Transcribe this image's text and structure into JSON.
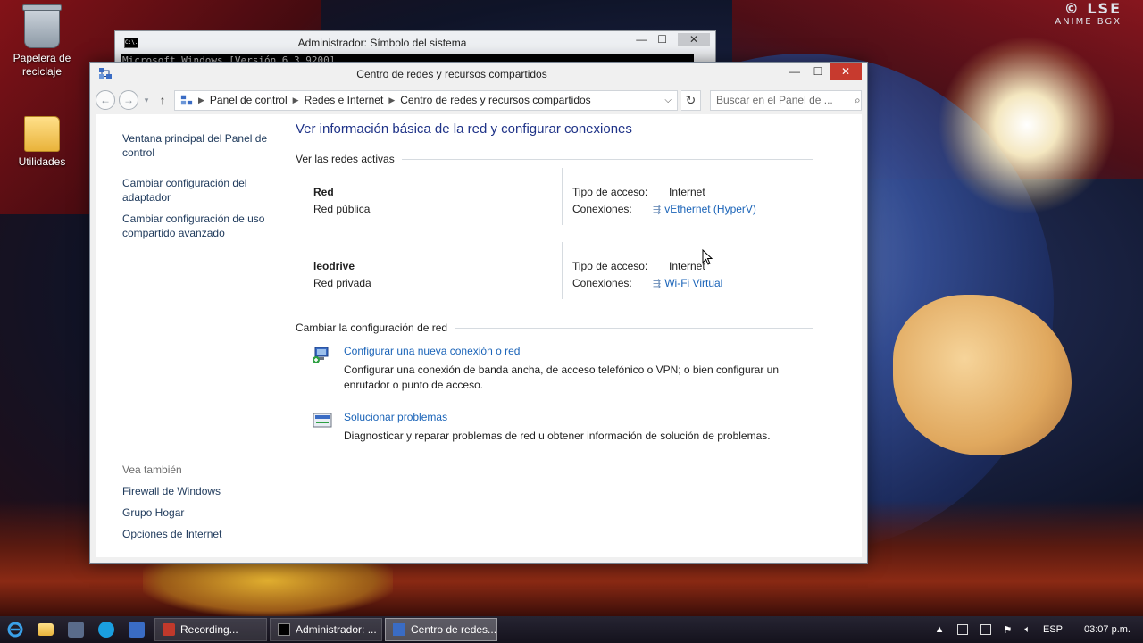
{
  "watermark": {
    "line1": "© LSE",
    "line2": "ANIME BGX"
  },
  "desktop": {
    "icons": [
      {
        "label": "Papelera de reciclaje"
      },
      {
        "label": "Utilidades"
      }
    ]
  },
  "cmd_window": {
    "title": "Administrador: Símbolo del sistema",
    "icon_text": "C:\\.",
    "first_line": "Microsoft Windows [Versión 6.3.9200]"
  },
  "window": {
    "title": "Centro de redes y recursos compartidos",
    "controls": {
      "minimize": "—",
      "maximize": "☐",
      "close": "✕"
    },
    "breadcrumb": [
      "Panel de control",
      "Redes e Internet",
      "Centro de redes y recursos compartidos"
    ],
    "search_placeholder": "Buscar en el Panel de ..."
  },
  "sidebar": {
    "links": [
      "Ventana principal del Panel de control",
      "Cambiar configuración del adaptador",
      "Cambiar configuración de uso compartido avanzado"
    ],
    "see_also_heading": "Vea también",
    "see_also": [
      "Firewall de Windows",
      "Grupo Hogar",
      "Opciones de Internet"
    ]
  },
  "main": {
    "title": "Ver información básica de la red y configurar conexiones",
    "active_networks_heading": "Ver las redes activas",
    "networks": [
      {
        "name": "Red",
        "type": "Red pública",
        "access_label": "Tipo de acceso:",
        "access": "Internet",
        "conn_label": "Conexiones:",
        "connection": "vEthernet (HyperV)"
      },
      {
        "name": "leodrive",
        "type": "Red privada",
        "access_label": "Tipo de acceso:",
        "access": "Internet",
        "conn_label": "Conexiones:",
        "connection": "Wi-Fi Virtual"
      }
    ],
    "change_settings_heading": "Cambiar la configuración de red",
    "tasks": [
      {
        "link": "Configurar una nueva conexión o red",
        "desc": "Configurar una conexión de banda ancha, de acceso telefónico o VPN; o bien configurar un enrutador o punto de acceso."
      },
      {
        "link": "Solucionar problemas",
        "desc": "Diagnosticar y reparar problemas de red u obtener información de solución de problemas."
      }
    ]
  },
  "taskbar": {
    "tasks": [
      {
        "label": "Recording...",
        "active": false
      },
      {
        "label": "Administrador: ...",
        "active": false
      },
      {
        "label": "Centro de redes...",
        "active": true
      }
    ],
    "language": "ESP",
    "clock": "03:07 p.m."
  }
}
